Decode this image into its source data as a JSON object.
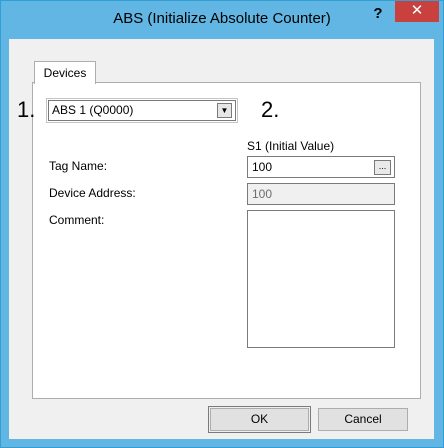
{
  "window": {
    "title": "ABS (Initialize Absolute Counter)",
    "help_label": "?",
    "close_label": "✕"
  },
  "tabs": [
    {
      "label": "Devices",
      "selected": true
    }
  ],
  "markers": {
    "one": "1.",
    "two": "2."
  },
  "device_select": {
    "value": "ABS 1 (Q0000)"
  },
  "fields": {
    "s1_header": "S1 (Initial Value)",
    "tag_name_label": "Tag Name:",
    "tag_name_value": "100",
    "device_address_label": "Device Address:",
    "device_address_value": "100",
    "comment_label": "Comment:",
    "comment_value": ""
  },
  "buttons": {
    "ok": "OK",
    "cancel": "Cancel",
    "browse": "..."
  }
}
